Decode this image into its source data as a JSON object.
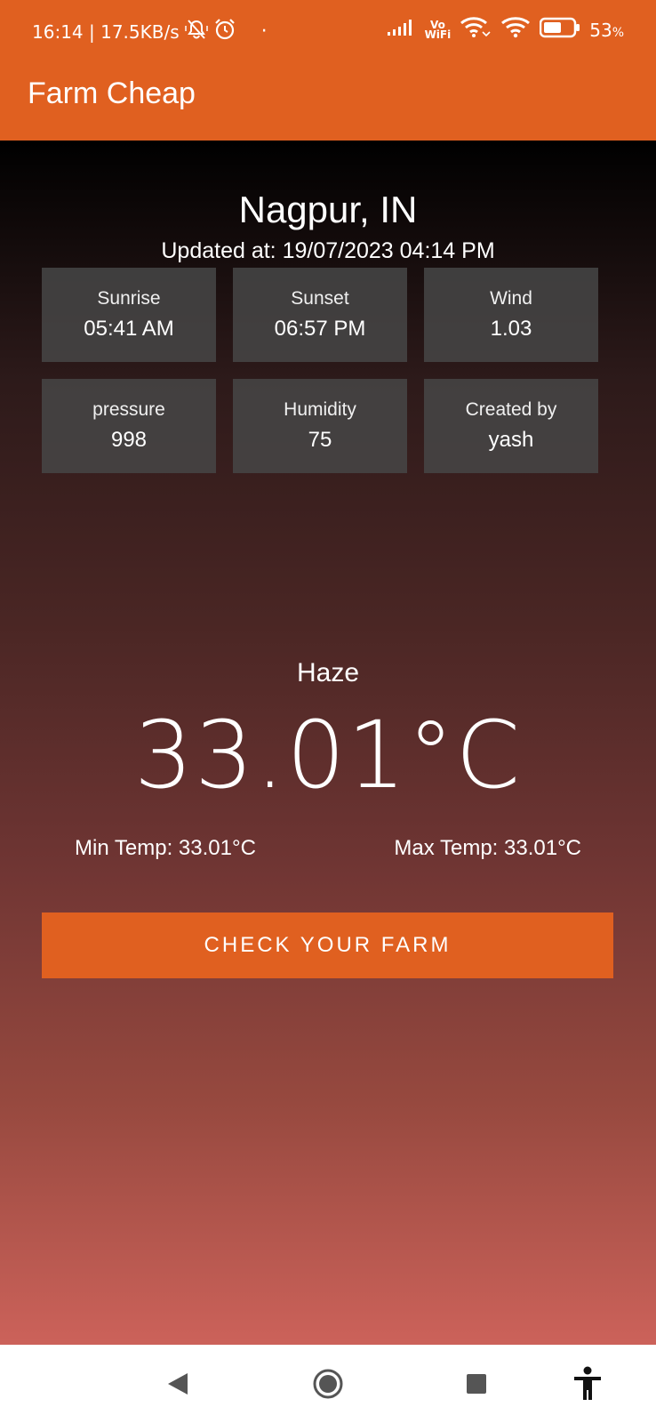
{
  "status_bar": {
    "time_speed": "16:14 | 17.5KB/s",
    "dot": "·",
    "vowifi_top": "Vo",
    "vowifi_bottom": "WiFi",
    "battery": "53",
    "battery_unit": "%",
    "icons": [
      "mute-vibrate-icon",
      "alarm-icon",
      "signal-icon",
      "wifi-calling-icon",
      "wifi-icon",
      "battery-icon"
    ]
  },
  "app_bar": {
    "title": "Farm Cheap"
  },
  "weather": {
    "city": "Nagpur, IN",
    "updated": "Updated at: 19/07/2023 04:14 PM",
    "cards": [
      {
        "label": "Sunrise",
        "value": "05:41 AM"
      },
      {
        "label": "Sunset",
        "value": "06:57 PM"
      },
      {
        "label": "Wind",
        "value": "1.03"
      },
      {
        "label": "pressure",
        "value": "998"
      },
      {
        "label": "Humidity",
        "value": "75"
      },
      {
        "label": "Created by",
        "value": "yash"
      }
    ],
    "condition": "Haze",
    "temperature": "33.01°C",
    "min_temp": "Min Temp: 33.01°C",
    "max_temp": "Max Temp: 33.01°C"
  },
  "actions": {
    "check_farm": "CHECK YOUR FARM"
  },
  "colors": {
    "accent": "#E06020",
    "card_bg": "#464646"
  },
  "nav_bar": {
    "icons": [
      "back-icon",
      "home-icon",
      "recents-icon",
      "accessibility-icon"
    ]
  }
}
